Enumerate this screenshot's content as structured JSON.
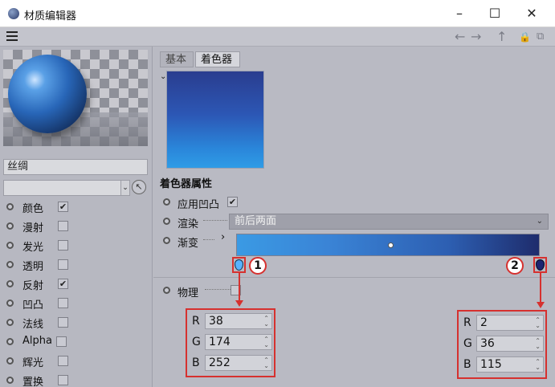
{
  "window": {
    "title": "材质编辑器",
    "minimize": "–",
    "maximize": "☐",
    "close": "✕"
  },
  "toolbar": {
    "back": "←",
    "forward": "→",
    "up": "↑",
    "lock": "🔒",
    "new_window": "⧉"
  },
  "material": {
    "name": "丝绸"
  },
  "channels": [
    {
      "label": "颜色",
      "checked": true
    },
    {
      "label": "漫射",
      "checked": false
    },
    {
      "label": "发光",
      "checked": false
    },
    {
      "label": "透明",
      "checked": false
    },
    {
      "label": "反射",
      "checked": true
    },
    {
      "label": "凹凸",
      "checked": false
    },
    {
      "label": "法线",
      "checked": false
    },
    {
      "label": "Alpha",
      "checked": false
    },
    {
      "label": "辉光",
      "checked": false
    },
    {
      "label": "置换",
      "checked": false
    }
  ],
  "tabs": [
    {
      "label": "基本",
      "active": false
    },
    {
      "label": "着色器",
      "active": true
    }
  ],
  "shader": {
    "section_title": "着色器属性",
    "apply_bump_label": "应用凹凸",
    "apply_bump_checked": true,
    "render_label": "渲染",
    "render_value": "前后两面",
    "gradient_label": "渐变",
    "gradient_expand": "›",
    "physics_label": "物理",
    "physics_checked": false
  },
  "gradient_knots": {
    "left": {
      "callout": "1",
      "R": "38",
      "G": "174",
      "B": "252",
      "color": "#26aefc"
    },
    "right": {
      "callout": "2",
      "R": "2",
      "G": "36",
      "B": "115",
      "color": "#022473"
    }
  },
  "colors": {
    "annotation_red": "#d6312f",
    "panel_bg": "#b9bac3"
  }
}
